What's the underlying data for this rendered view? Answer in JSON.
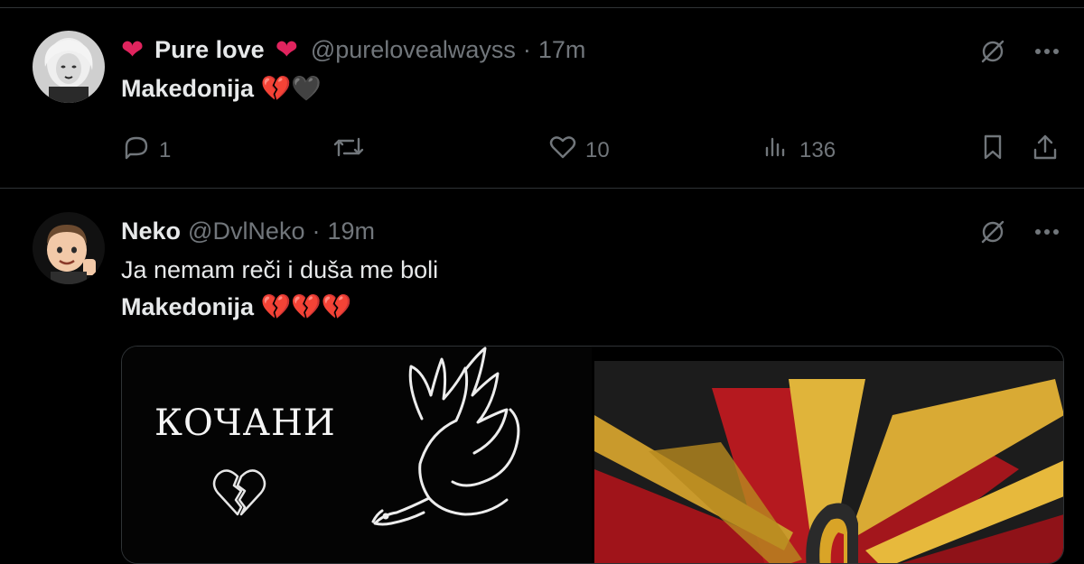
{
  "tweets": [
    {
      "display_name": "Pure love",
      "name_emoji_left": "❤",
      "name_emoji_right": "❤",
      "handle": "@purelovealwayss",
      "separator": "·",
      "time": "17m",
      "text_bold": "Makedonija",
      "text_emojis": "💔🖤",
      "actions": {
        "reply_count": "1",
        "retweet_count": "",
        "like_count": "10",
        "view_count": "136"
      }
    },
    {
      "display_name": "Neko",
      "handle": "@DvlNeko",
      "separator": "·",
      "time": "19m",
      "text_line1": "Ja nemam reči i duša me boli",
      "text_bold": "Makedonija",
      "text_emojis": "💔💔💔",
      "media": {
        "left_caption": "КОЧАНИ"
      }
    }
  ],
  "colors": {
    "background": "#000000",
    "text_primary": "#e7e9ea",
    "text_secondary": "#71767b",
    "divider": "#2f3336",
    "heart": "#e0245e"
  },
  "icons": {
    "grok": "slash-circle-icon",
    "more": "more-dots-icon",
    "reply": "reply-bubble-icon",
    "retweet": "retweet-icon",
    "like": "heart-icon",
    "views": "views-bar-icon",
    "bookmark": "bookmark-icon",
    "share": "share-icon"
  }
}
